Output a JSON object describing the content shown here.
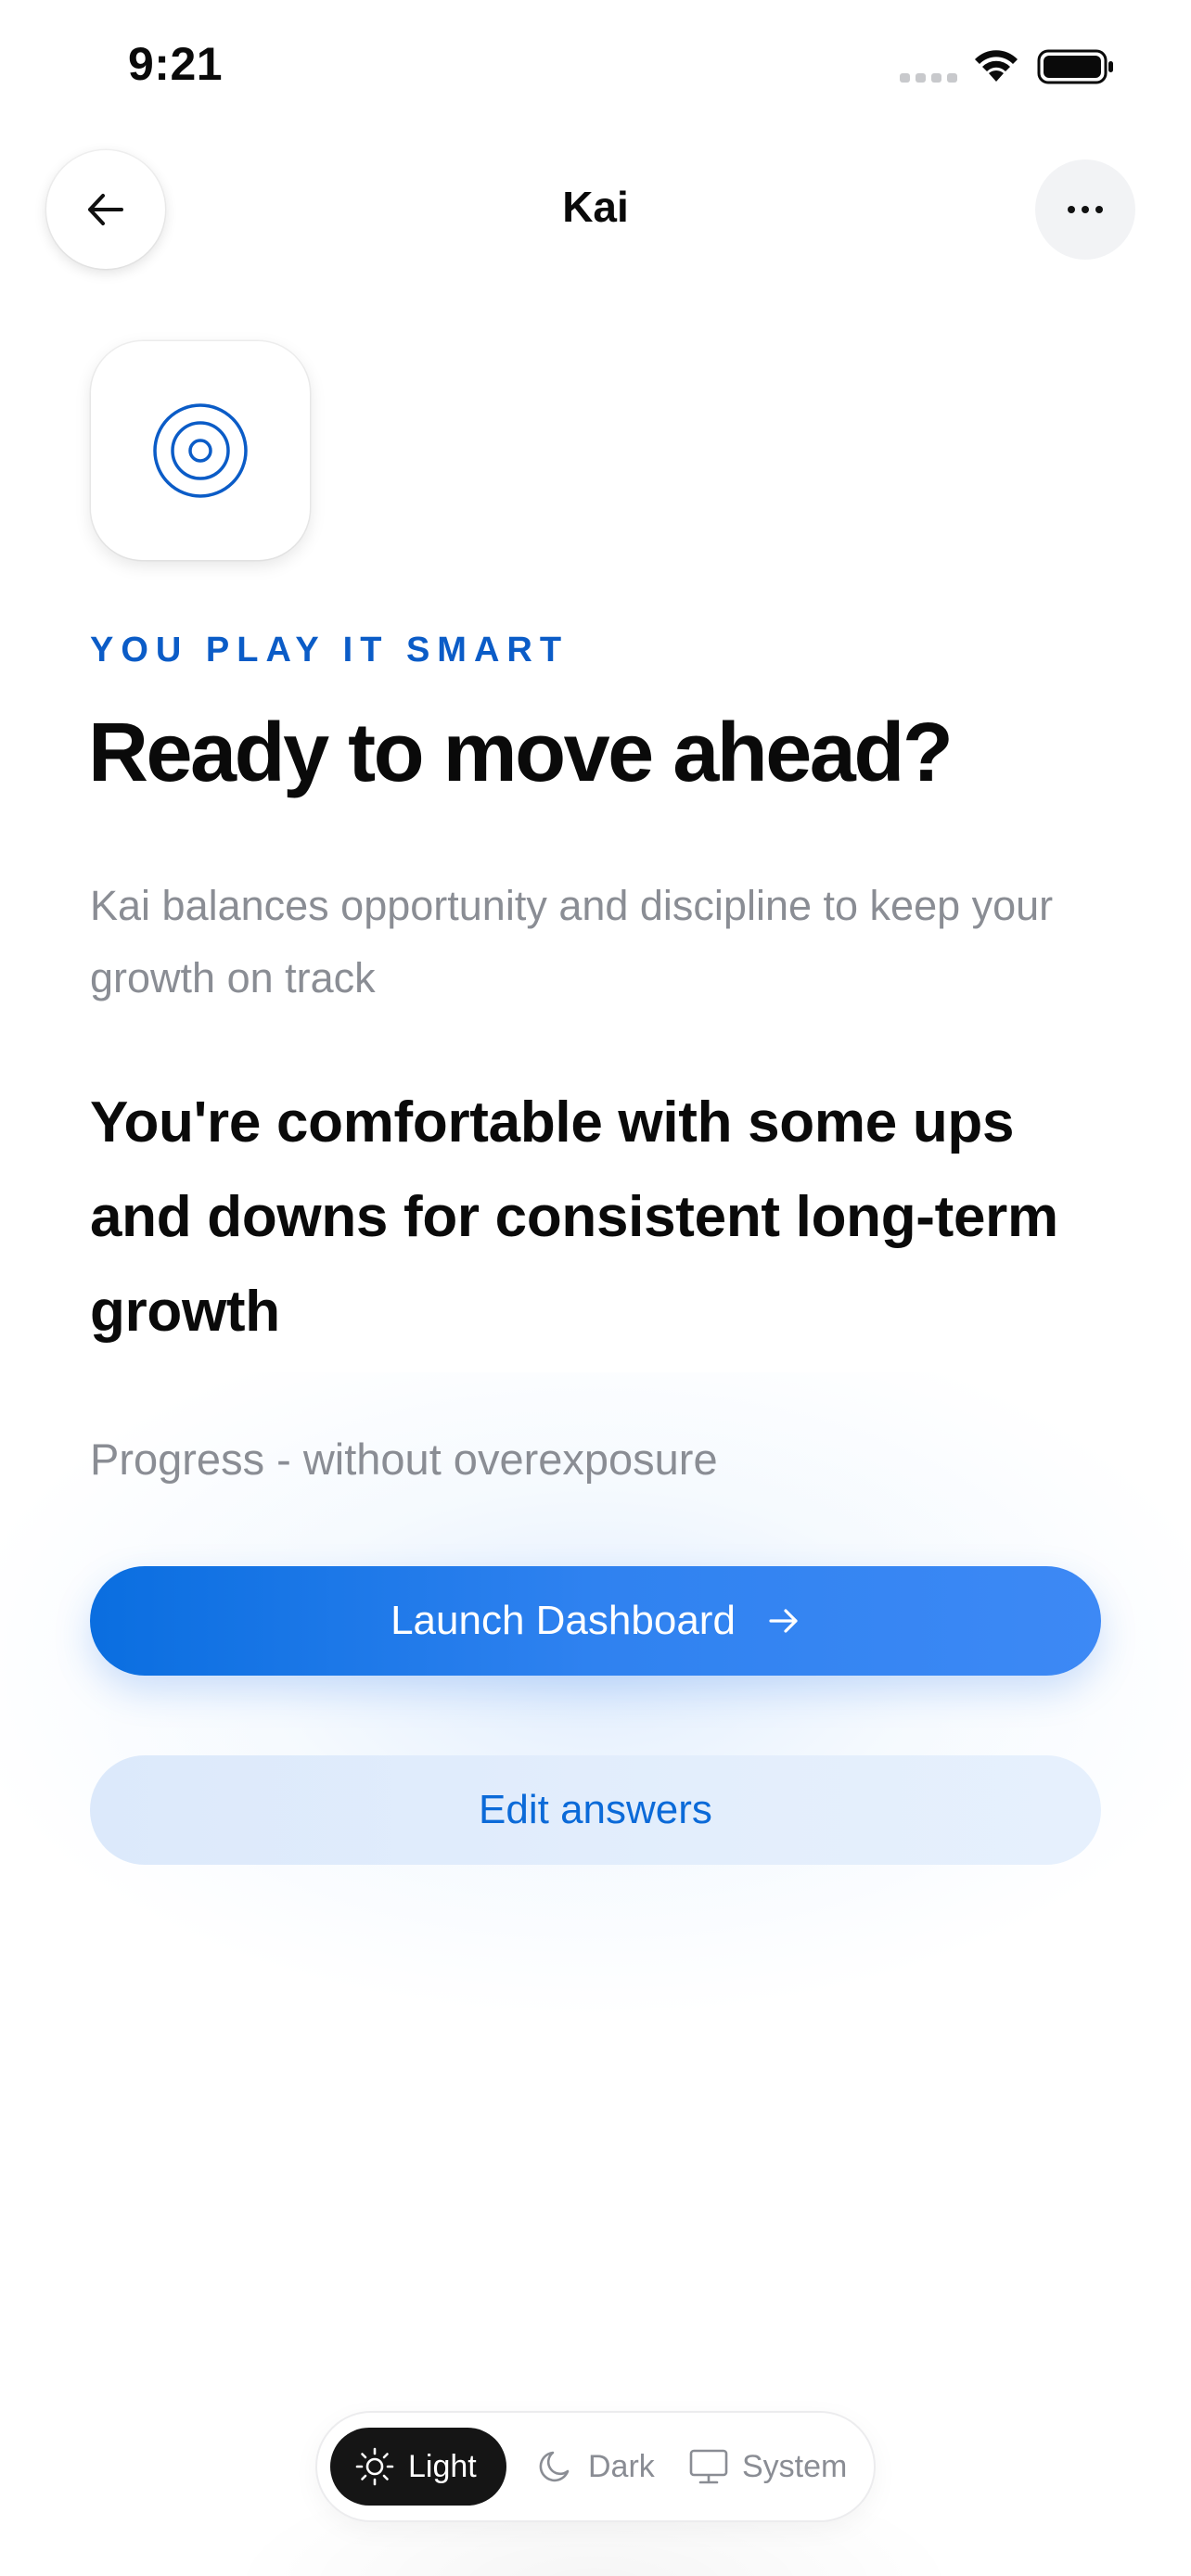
{
  "status_bar": {
    "time": "9:21"
  },
  "nav": {
    "title": "Kai",
    "back_icon": "arrow-left-icon",
    "more_icon": "ellipsis-horizontal-icon"
  },
  "app_tile": {
    "icon": "target-rings-icon"
  },
  "content": {
    "eyebrow": "YOU PLAY IT SMART",
    "headline": "Ready to move ahead?",
    "subtitle": "Kai balances opportunity and discipline to keep your growth on track",
    "profile_statement": "You're comfortable with some ups and downs for consistent long-term growth",
    "tagline": "Progress - without overexposure"
  },
  "actions": {
    "launch_label": "Launch Dashboard",
    "launch_icon": "arrow-right-icon",
    "edit_label": "Edit answers"
  },
  "theme_switcher": {
    "options": [
      {
        "label": "Light",
        "icon": "sun-icon",
        "active": true
      },
      {
        "label": "Dark",
        "icon": "moon-icon",
        "active": false
      },
      {
        "label": "System",
        "icon": "monitor-icon",
        "active": false
      }
    ]
  },
  "colors": {
    "accent": "#0b5cc7",
    "primary_button": "#1f78e8",
    "secondary_button_bg": "#e0ecfc",
    "text_muted": "#8a8d94",
    "theme_active_bg": "#151515"
  }
}
